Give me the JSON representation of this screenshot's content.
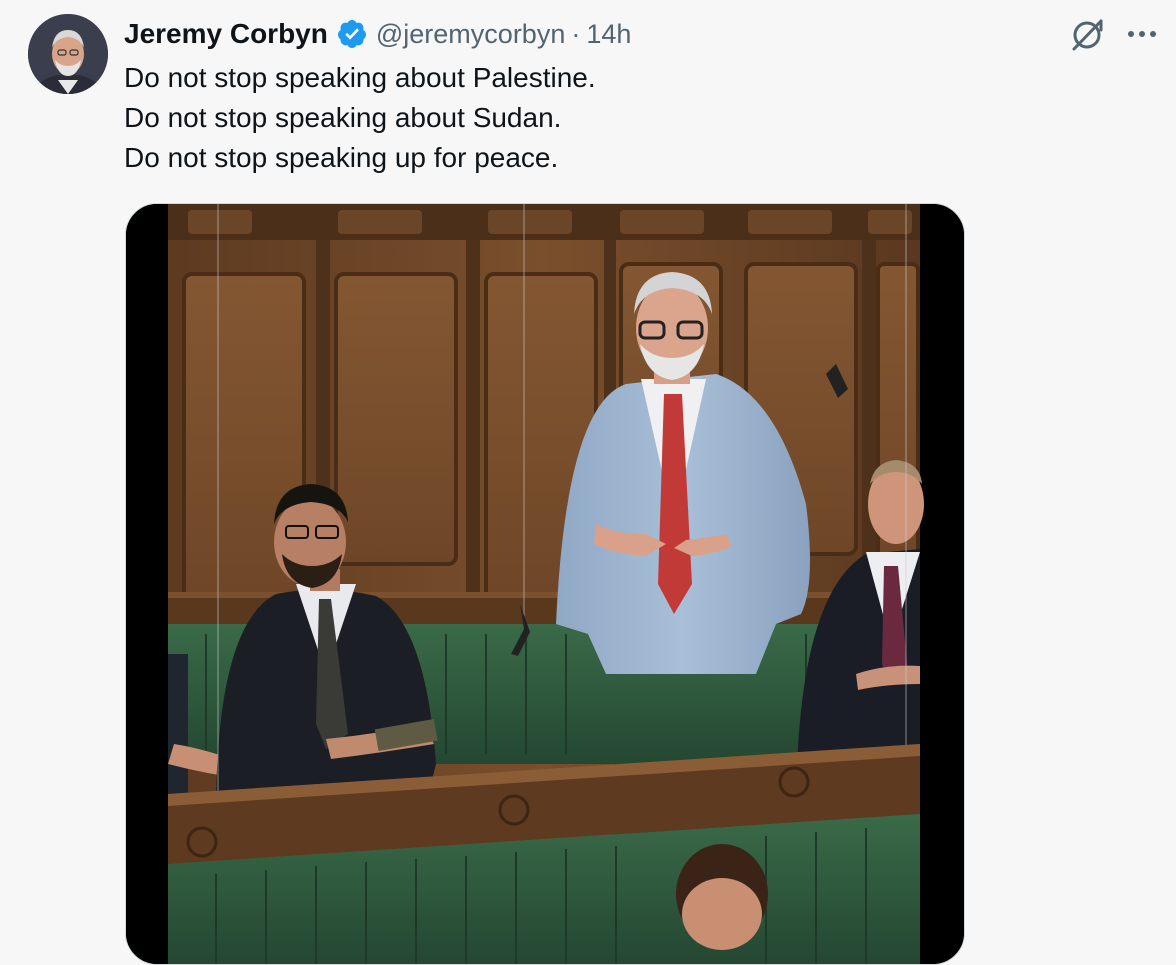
{
  "author": {
    "display_name": "Jeremy Corbyn",
    "handle": "@jeremycorbyn",
    "separator": "·",
    "timestamp": "14h",
    "verified": true
  },
  "tweet": {
    "lines": [
      "Do not stop speaking about Palestine.",
      "Do not stop speaking about Sudan.",
      "Do not stop speaking up for peace."
    ]
  },
  "icons": {
    "verified": "verified-badge-icon",
    "grok": "grok-icon",
    "more": "more-options-icon"
  },
  "colors": {
    "background": "#f7f7f7",
    "text_primary": "#0f1419",
    "text_secondary": "#536471",
    "verified_blue": "#1d9bf0",
    "bench_green": "#2f5a3c",
    "panelling_wood": "#6b4527"
  }
}
